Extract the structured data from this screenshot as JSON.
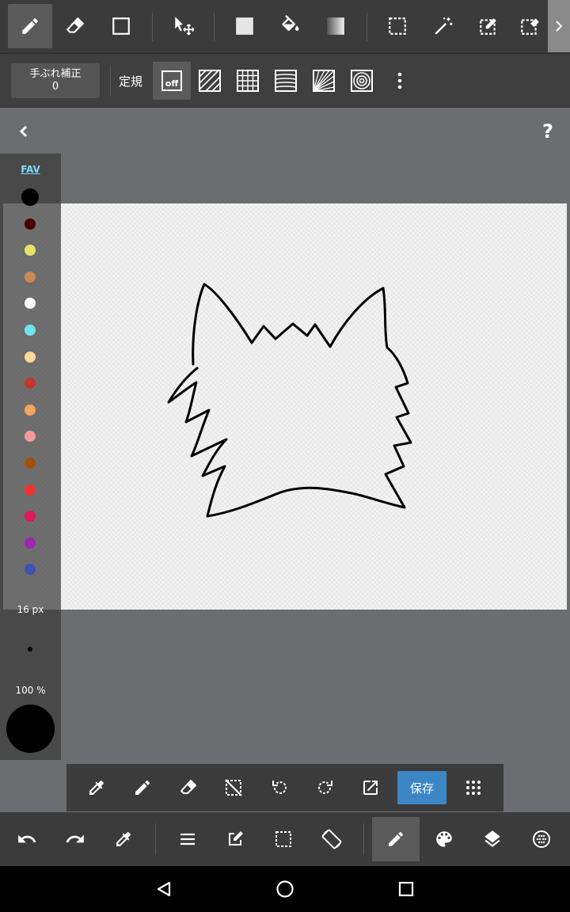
{
  "top_toolbar": {
    "tools": [
      "pencil-icon",
      "eraser-icon",
      "shape-icon",
      "move-icon",
      "fill-rect-icon",
      "bucket-icon",
      "gradient-icon",
      "select-icon",
      "magic-wand-icon",
      "select-pen-icon",
      "select-eraser-icon"
    ],
    "active_tool": "pencil-icon"
  },
  "sub_toolbar": {
    "stabilizer_label": "手ぶれ補正",
    "stabilizer_value": "0",
    "ruler_label": "定規",
    "ruler_off_label": "off"
  },
  "color_panel": {
    "fav_label": "FAV",
    "colors": [
      "#000000",
      "#4a0000",
      "#e4e46a",
      "#c98a5a",
      "#ffffff",
      "#6fe4f0",
      "#ffd89a",
      "#c0392b",
      "#f4a460",
      "#f29a9a",
      "#a0520a",
      "#ee3333",
      "#e0195f",
      "#9b27b0",
      "#3f51b5"
    ],
    "brush_size": "16 px",
    "opacity": "100 %",
    "current_color": "#000000"
  },
  "quick_bar": {
    "save_label": "保存"
  },
  "accent_color": "#3d86c6"
}
